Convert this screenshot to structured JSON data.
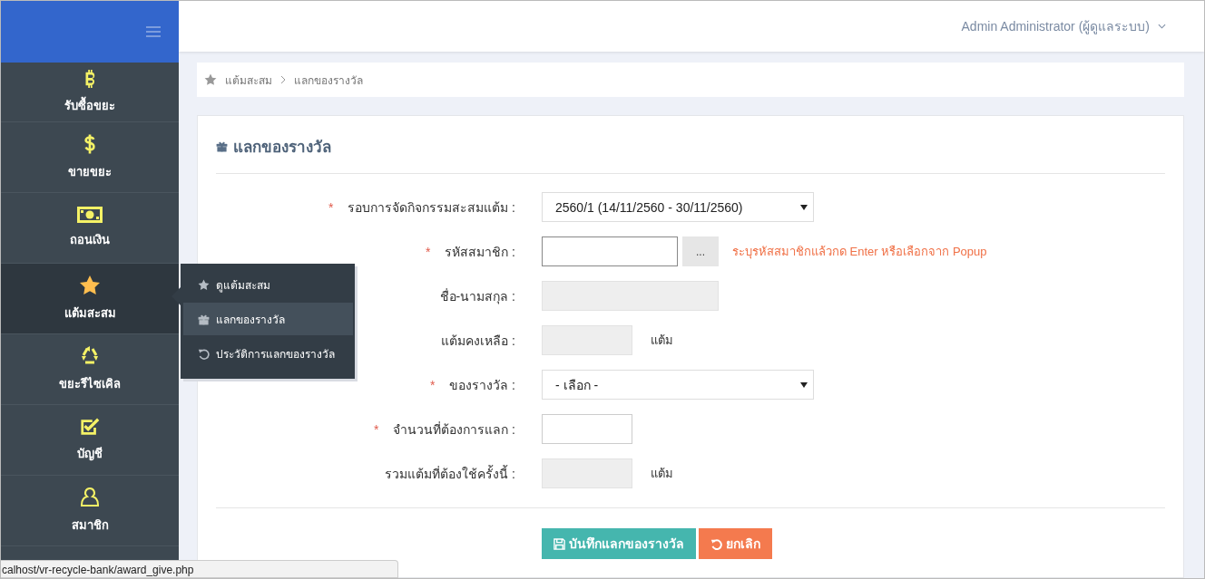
{
  "user_menu": {
    "label": "Admin Administrator (ผู้ดูแลระบบ)"
  },
  "sidebar": {
    "items": [
      {
        "label": "รับซื้อขยะ",
        "kind": "bitcoin",
        "selected": false
      },
      {
        "label": "ขายขยะ",
        "kind": "dollar",
        "selected": false
      },
      {
        "label": "ถอนเงิน",
        "kind": "banknote",
        "selected": false
      },
      {
        "label": "แต้มสะสม",
        "kind": "star",
        "selected": true
      },
      {
        "label": "ขยะรีไซเคิล",
        "kind": "recycle",
        "selected": false
      },
      {
        "label": "บัญชี",
        "kind": "check",
        "selected": false
      },
      {
        "label": "สมาชิก",
        "kind": "user",
        "selected": false
      }
    ]
  },
  "flyout": {
    "items": [
      {
        "label": "ดูแต้มสะสม",
        "kind": "star",
        "selected": false
      },
      {
        "label": "แลกของรางวัล",
        "kind": "gift",
        "selected": true
      },
      {
        "label": "ประวัติการแลกของรางวัล",
        "kind": "history",
        "selected": false
      }
    ]
  },
  "breadcrumb": [
    "แต้มสะสม",
    "แลกของรางวัล"
  ],
  "panel": {
    "title": "แลกของรางวัล"
  },
  "form": [
    {
      "kind": "select",
      "label": "รอบการจัดกิจกรรมสะสมแต้ม :",
      "required_mark": "*",
      "value": "2560/1  (14/11/2560 - 30/11/2560)"
    },
    {
      "kind": "lookup",
      "label": "รหัสสมาชิก :",
      "required_mark": "*",
      "button": "...",
      "hint": "ระบุรหัสสมาชิกแล้วกด Enter หรือเลือกจาก Popup"
    },
    {
      "kind": "readonly-wide",
      "label": "ชื่อ-นามสกุล :"
    },
    {
      "kind": "readonly",
      "label": "แต้มคงเหลือ :",
      "unit": "แต้ม"
    },
    {
      "kind": "select",
      "label": "ของรางวัล :",
      "required_mark": "*",
      "value": "- เลือก -"
    },
    {
      "kind": "input",
      "label": "จำนวนที่ต้องการแลก :",
      "required_mark": "*"
    },
    {
      "kind": "readonly",
      "label": "รวมแต้มที่ต้องใช้ครั้งนี้ :",
      "unit": "แต้ม"
    }
  ],
  "buttons": [
    {
      "label": "บันทึกแลกของรางวัล",
      "kind": "save"
    },
    {
      "label": "ยกเลิก",
      "kind": "cancel"
    }
  ],
  "status_bar": {
    "url": "calhost/vr-recycle-bank/award_give.php"
  }
}
